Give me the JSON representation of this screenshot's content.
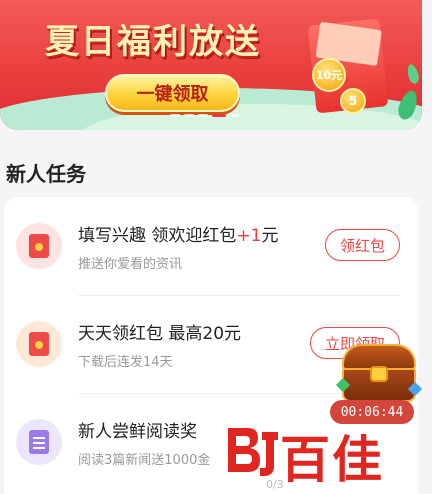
{
  "banner": {
    "title": "夏日福利放送",
    "button_label": "一键领取",
    "coin_large": "10元",
    "coin_small": "5",
    "pager_count": 5,
    "pager_active": 4
  },
  "section_title": "新人任务",
  "tasks": [
    {
      "title": "填写兴趣 领欢迎红包",
      "bonus": "+1",
      "unit": "元",
      "desc": "推送你爱看的资讯",
      "button_label": "领红包",
      "icon": "red-envelope-icon"
    },
    {
      "title": "天天领红包 最高20元",
      "desc": "下载后连发14天",
      "button_label": "立即领取",
      "icon": "red-envelope-icon"
    },
    {
      "title": "新人尝鲜阅读奖",
      "desc": "阅读3篇新闻送1000金",
      "progress": "0/3",
      "icon": "document-icon"
    }
  ],
  "floating": {
    "timer": "00:06:44",
    "icon": "treasure-chest-icon"
  },
  "watermark": {
    "text": "百佳",
    "logo": "BJ"
  },
  "colors": {
    "accent": "#e93c3c",
    "banner_red": "#f25b57",
    "button_yellow": "#ffd43e",
    "card_bg": "#ffffff",
    "page_bg": "#f5f5f7"
  }
}
